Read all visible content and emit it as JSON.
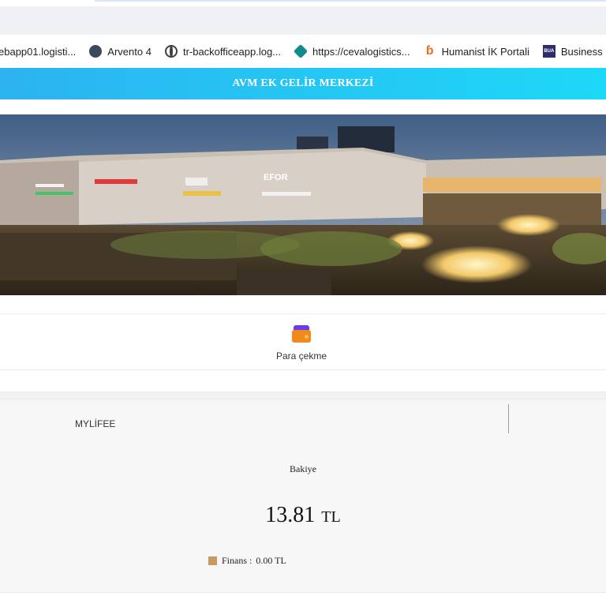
{
  "browser": {
    "bookmarks": [
      {
        "label": "ebapp01.logisti...",
        "icon": "none"
      },
      {
        "label": "Arvento 4",
        "icon": "arvento-icon"
      },
      {
        "label": "tr-backofficeapp.log...",
        "icon": "globe-icon"
      },
      {
        "label": "https://cevalogistics...",
        "icon": "sharepoint-icon"
      },
      {
        "label": "Humanist İK Portali",
        "icon": "humanist-icon"
      },
      {
        "label": "Business Univ",
        "icon": "bua-icon",
        "icon_text": "BUA"
      }
    ]
  },
  "header": {
    "title": "AVM EK GELİR MERKEZİ",
    "gradient": [
      "#2cb3f0",
      "#1ed8f7"
    ]
  },
  "banner": {
    "image": "shopping-mall-evening-photo",
    "signs": [
      "EFOR"
    ],
    "slides": 3,
    "active_slide": 2
  },
  "menu": {
    "items": [
      {
        "label": "Para çekme",
        "icon": "wallet-icon"
      }
    ]
  },
  "account": {
    "name": "MYLİFEE",
    "balance_label": "Bakiye",
    "balance_value": "13.81",
    "currency": "TL",
    "finans_label": "Finans :",
    "finans_value": "0.00 TL",
    "finans_color": "#c89a5f"
  }
}
